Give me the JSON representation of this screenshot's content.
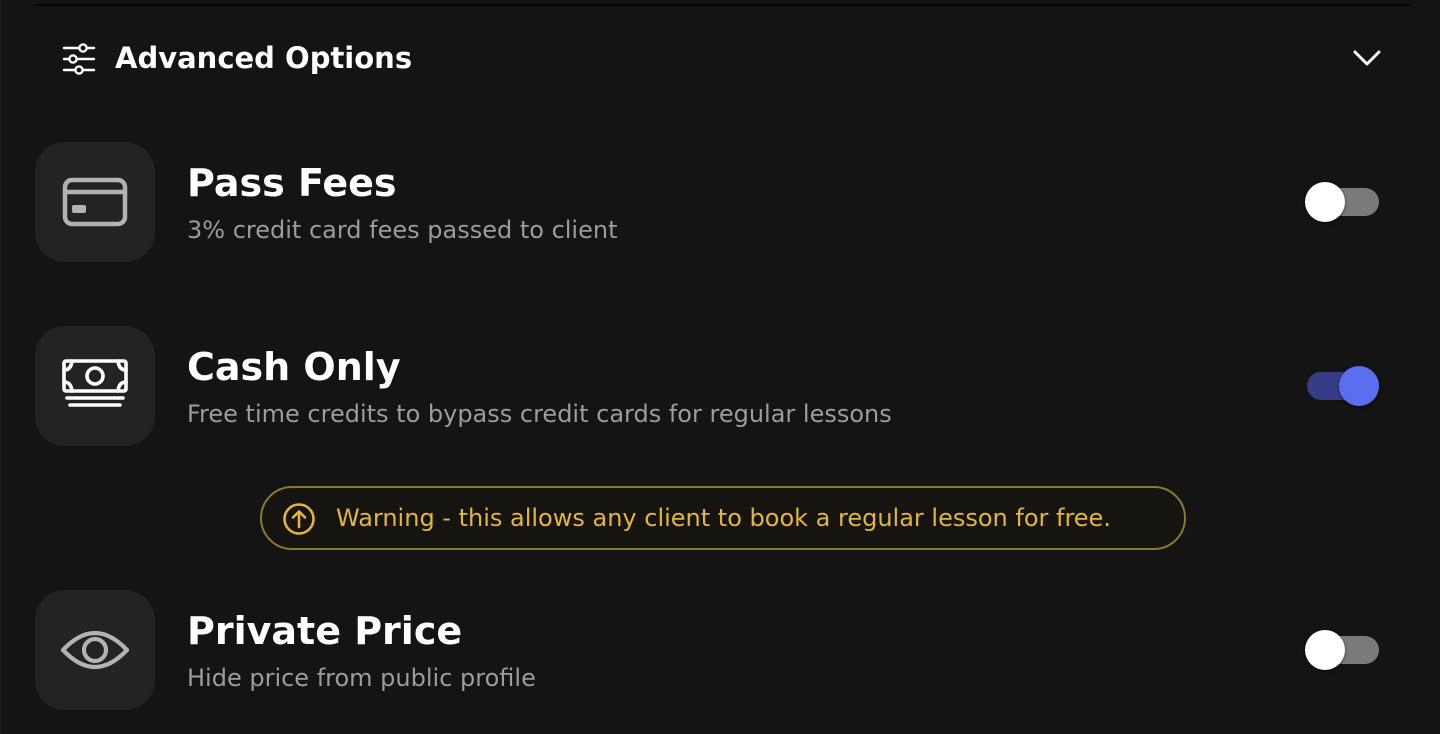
{
  "advanced_options": {
    "title": "Advanced Options",
    "header_icon": "sliders-icon",
    "expand_icon": "chevron-down-icon"
  },
  "options": [
    {
      "title": "Pass Fees",
      "description": "3% credit card fees passed to client",
      "icon": "credit-card-icon",
      "enabled": false
    },
    {
      "title": "Cash Only",
      "description": "Free time credits to bypass credit cards for regular lessons",
      "icon": "cash-icon",
      "enabled": true
    },
    {
      "title": "Private Price",
      "description": "Hide price from public profile",
      "icon": "eye-icon",
      "enabled": false
    }
  ],
  "warning": {
    "text": "Warning - this allows any client to book a regular lesson for free.",
    "icon": "arrow-up-circle-icon"
  },
  "colors": {
    "background": "#141414",
    "icon_tile": "#232325",
    "toggle_on_knob": "#5b6ef0",
    "toggle_on_track": "#363d86",
    "toggle_off_track": "#7a7a7c",
    "warning": "#e3b53b"
  }
}
